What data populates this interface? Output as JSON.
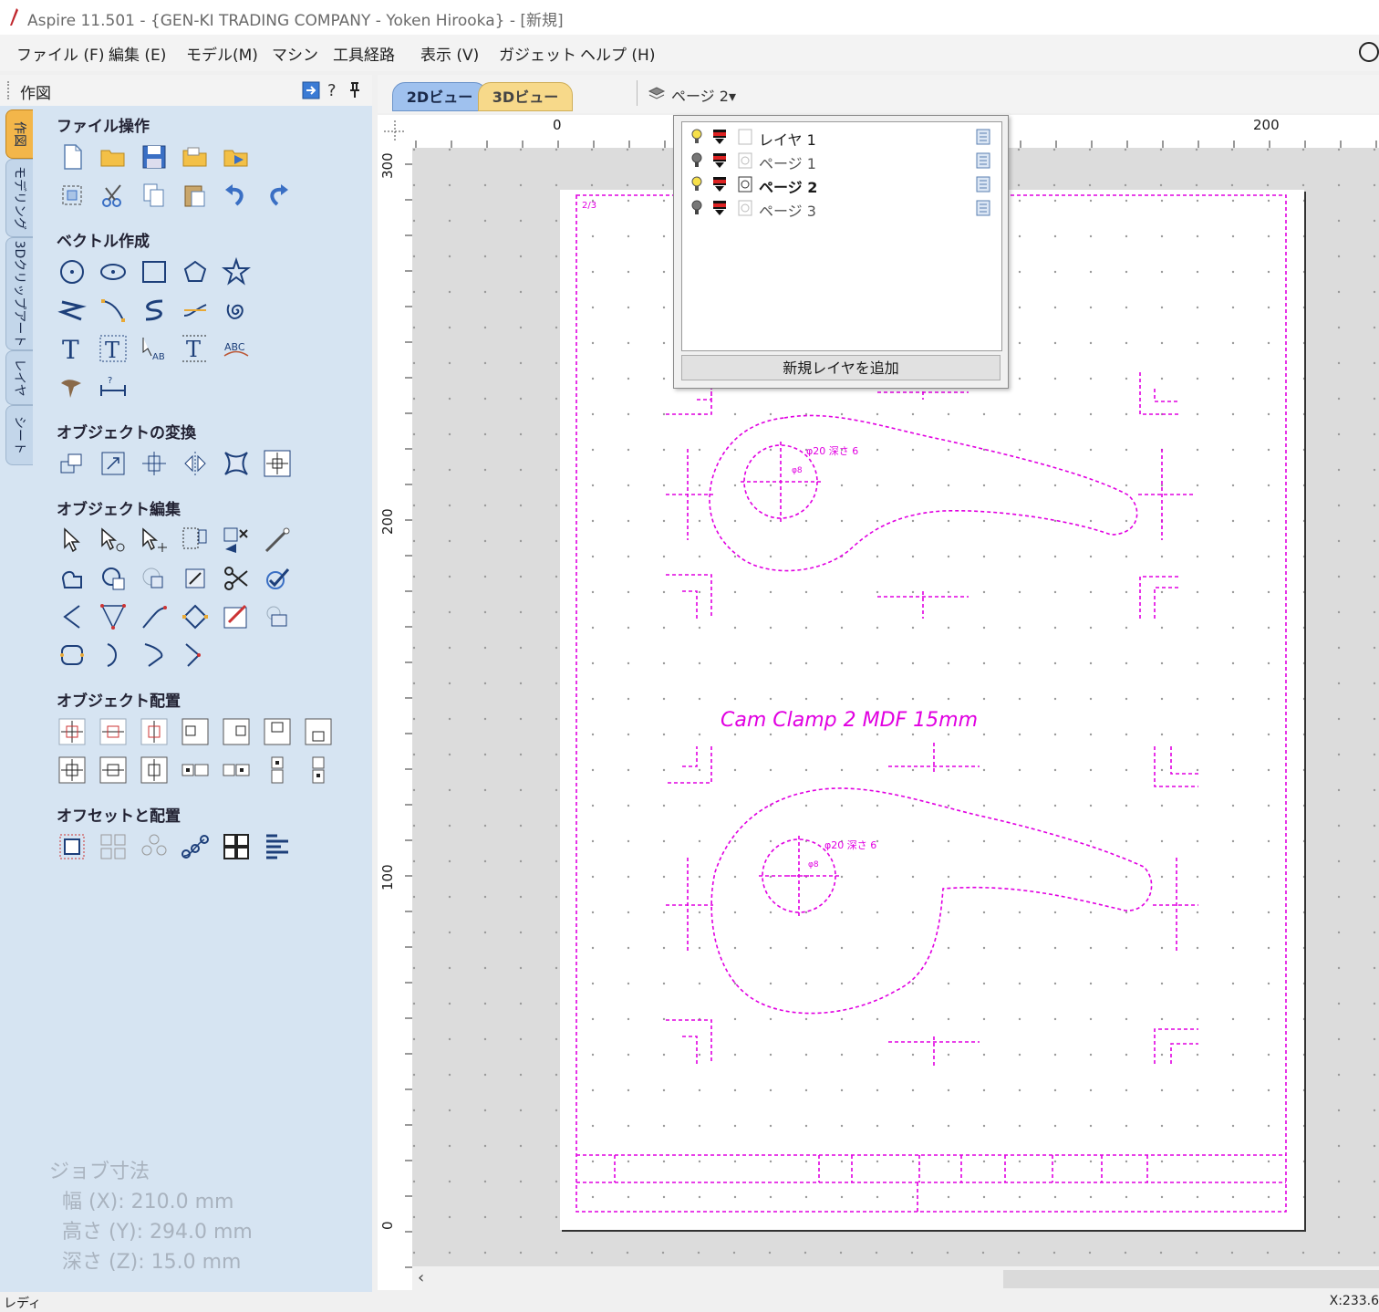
{
  "window": {
    "title": "Aspire 11.501 - {GEN-KI TRADING COMPANY - Yoken Hirooka} - [新規]"
  },
  "menu": [
    "ファイル (F)",
    "編集 (E)",
    "モデル(M)",
    "マシン",
    "工具経路",
    "表示 (V)",
    "ガジェット",
    "ヘルプ (H)"
  ],
  "panel": {
    "title": "作図",
    "side_tabs": [
      "作図",
      "モデリング",
      "3Dクリップアート",
      "レイヤ",
      "シート"
    ],
    "sections": {
      "file_ops": "ファイル操作",
      "vector_create": "ベクトル作成",
      "transform": "オブジェクトの変換",
      "edit": "オブジェクト編集",
      "align": "オブジェクト配置",
      "offset": "オフセットと配置"
    },
    "job_dims": {
      "title": "ジョブ寸法",
      "width": "幅 (X): 210.0 mm",
      "height": "高さ (Y): 294.0 mm",
      "depth": "深さ (Z): 15.0 mm"
    }
  },
  "view_tabs": {
    "tab_2d": "2Dビュー",
    "tab_3d": "3Dビュー",
    "page_select": "ページ 2▾"
  },
  "ruler": {
    "top_labels": [
      "0",
      "200"
    ],
    "left_labels": [
      "300",
      "200",
      "100",
      "0"
    ]
  },
  "layers": {
    "rows": [
      {
        "name": "レイヤ 1",
        "bold": false,
        "lit": true
      },
      {
        "name": "ページ 1",
        "bold": false,
        "lit": false
      },
      {
        "name": "ページ 2",
        "bold": true,
        "lit": true
      },
      {
        "name": "ページ 3",
        "bold": false,
        "lit": false
      }
    ],
    "add_button": "新規レイヤを追加"
  },
  "drawing": {
    "label": "Cam Clamp 2   MDF 15mm",
    "hole_note_1": "φ20 深さ 6",
    "hole_inner_1": "φ8",
    "hole_note_2": "φ20 深さ 6",
    "hole_inner_2": "φ8",
    "corner_mark": "2/3"
  },
  "status": {
    "left": "レディ",
    "right": "X:233.6"
  },
  "colors": {
    "accent": "#e100e1",
    "panel_bg": "#d6e4f2",
    "tab_2d": "#9fc1ee",
    "tab_3d": "#f7d98a"
  }
}
